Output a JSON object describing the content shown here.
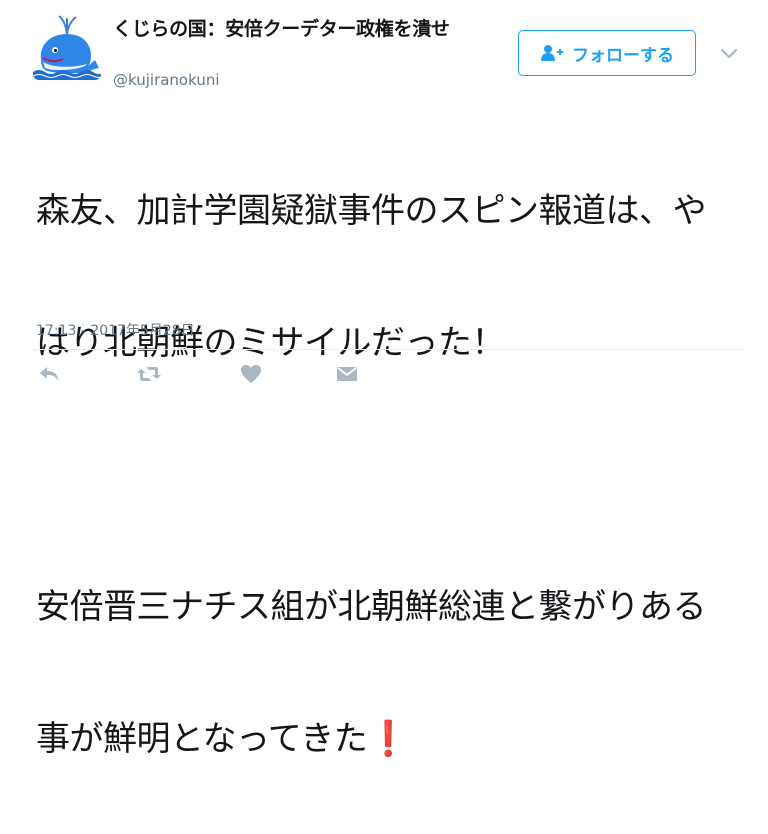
{
  "user": {
    "display_name": "くじらの国：安倍クーデター政権を潰せ",
    "screen_name": "@kujiranokuni",
    "avatar_icon": "whale-icon"
  },
  "follow": {
    "label": "フォローする",
    "icon": "add-user-icon",
    "accent_color": "#1da1f2"
  },
  "tweet": {
    "lines": [
      "森友、加計学園疑獄事件のスピン報道は、や",
      "はり北朝鮮のミサイルだった！",
      "",
      "安倍晋三ナチス組が北朝鮮総連と繋がりある",
      "事が鮮明となってきた"
    ],
    "emoji": "❗",
    "timestamp": "17:13 - 2017年5月28日"
  },
  "actions": [
    {
      "name": "reply",
      "icon": "reply-icon"
    },
    {
      "name": "retweet",
      "icon": "retweet-icon"
    },
    {
      "name": "like",
      "icon": "heart-icon"
    },
    {
      "name": "message",
      "icon": "envelope-icon"
    }
  ],
  "colors": {
    "text": "#14171a",
    "muted": "#657786",
    "icon": "#aab8c2",
    "divider": "#e6ecf0",
    "emoji": "#e0182d"
  }
}
